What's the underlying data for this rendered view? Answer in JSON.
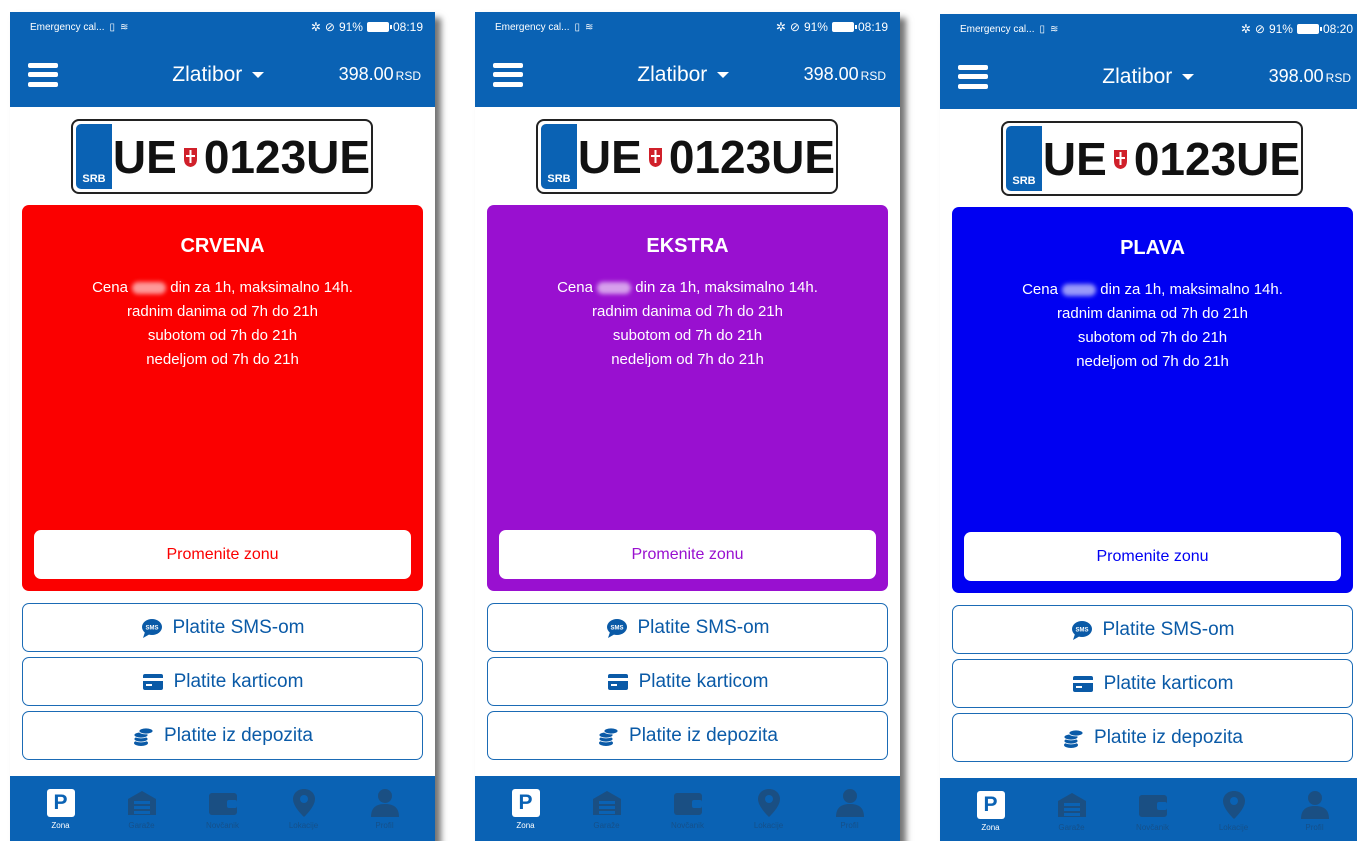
{
  "common": {
    "status_left": "Emergency cal...",
    "battery": "91%",
    "city": "Zlatibor",
    "balance_amount": "398.00",
    "balance_currency": "RSD",
    "plate_country": "SRB",
    "plate_left": "UE",
    "plate_right": "0123UE",
    "change_zone": "Promenite zonu",
    "pay_sms": "Platite SMS-om",
    "pay_card": "Platite karticom",
    "pay_deposit": "Platite iz depozita",
    "price_prefix": "Cena",
    "price_suffix": "din za 1h, maksimalno 14h.",
    "hours_weekdays": "radnim danima od 7h do 21h",
    "hours_saturday": "subotom od 7h do 21h",
    "hours_sunday": "nedeljom od 7h do 21h",
    "nav": [
      "Zona",
      "Garaže",
      "Novčanik",
      "Lokacije",
      "Profil"
    ]
  },
  "screens": [
    {
      "time": "08:19",
      "zone_name": "CRVENA",
      "zone_color": "#fb0000"
    },
    {
      "time": "08:19",
      "zone_name": "EKSTRA",
      "zone_color": "#9910d0"
    },
    {
      "time": "08:20",
      "zone_name": "PLAVA",
      "zone_color": "#0000f2"
    }
  ],
  "colors": {
    "brand": "#0a62b4",
    "pay_text": "#0a5aa7"
  },
  "icons": [
    "hamburger-menu-icon",
    "caret-down-icon",
    "sms-bubble-icon",
    "credit-card-icon",
    "coins-icon",
    "parking-p-icon",
    "garage-icon",
    "wallet-icon",
    "location-pin-icon",
    "profile-icon",
    "serbian-crest-icon"
  ]
}
